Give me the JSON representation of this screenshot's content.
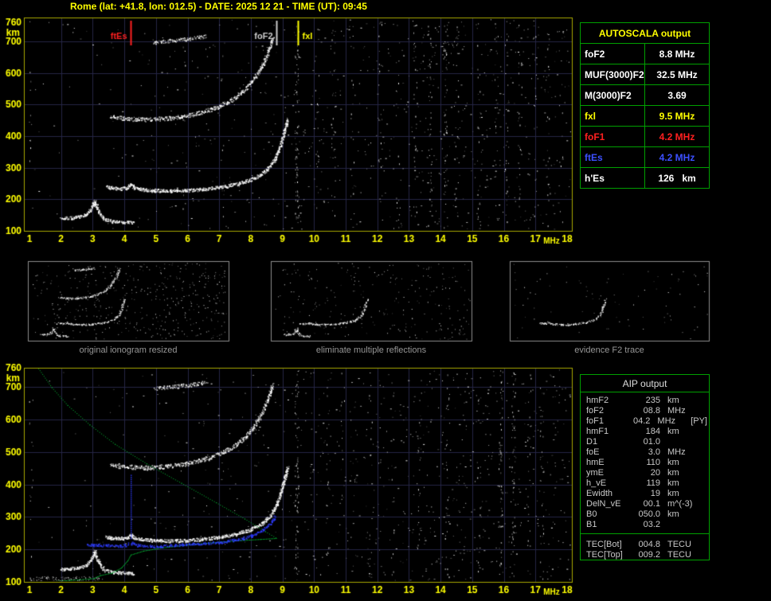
{
  "title": "Rome (lat: +41.8, lon: 012.5) - DATE: 2025 12 21 - TIME (UT): 09:45",
  "colors": {
    "background": "#000000",
    "axis_text": "#ffff00",
    "plot_border": "#a8a800",
    "grid": "#262646",
    "trace_white": "#ffffff",
    "profile_green": "#00b432",
    "restored_blue": "#2e3cff",
    "table_border": "#00a000",
    "caption_gray": "#969696",
    "aip_text": "#c8c8c8",
    "thumb_border": "#8c8c8c"
  },
  "ionogram_axes": {
    "x_ticks": [
      1,
      2,
      3,
      4,
      5,
      6,
      7,
      8,
      9,
      10,
      11,
      12,
      13,
      14,
      15,
      16,
      17,
      18
    ],
    "x_unit": "MHz",
    "y_ticks": [
      100,
      200,
      300,
      400,
      500,
      600,
      700,
      760
    ],
    "y_unit": "km",
    "x_range": [
      1,
      18
    ],
    "y_range": [
      100,
      760
    ]
  },
  "markers": [
    {
      "label": "ftEs",
      "freq": 4.2,
      "color": "#ff2020",
      "label_side": "left"
    },
    {
      "label": "foF2",
      "freq": 8.8,
      "color": "#cccccc",
      "label_side": "left"
    },
    {
      "label": "fxl",
      "freq": 9.5,
      "color": "#ffff00",
      "label_side": "right"
    }
  ],
  "autoscala_table": {
    "header": "AUTOSCALA output",
    "rows": [
      {
        "param": "foF2",
        "value": "8.8 MHz",
        "color": "#ffffff"
      },
      {
        "param": "MUF(3000)F2",
        "value": "32.5 MHz",
        "color": "#ffffff"
      },
      {
        "param": "M(3000)F2",
        "value": "3.69",
        "color": "#ffffff"
      },
      {
        "param": "fxl",
        "value": "9.5 MHz",
        "color": "#ffff00"
      },
      {
        "param": "foF1",
        "value": "4.2 MHz",
        "color": "#ff2020"
      },
      {
        "param": "ftEs",
        "value": "4.2 MHz",
        "color": "#3c50ff"
      },
      {
        "param": "h'Es",
        "value": "126   km",
        "color": "#ffffff"
      }
    ]
  },
  "thumbnails": [
    {
      "caption": "original ionogram resized"
    },
    {
      "caption": "eliminate multiple reflections"
    },
    {
      "caption": "evidence F2 trace"
    }
  ],
  "aip_table": {
    "header": "AIP output",
    "rows": [
      {
        "param": "hmF2",
        "value": "235",
        "unit": "km",
        "note": ""
      },
      {
        "param": "foF2",
        "value": "08.8",
        "unit": "MHz",
        "note": ""
      },
      {
        "param": "foF1",
        "value": "04.2",
        "unit": "MHz",
        "note": "[PY]"
      },
      {
        "param": "hmF1",
        "value": "184",
        "unit": "km",
        "note": ""
      },
      {
        "param": "D1",
        "value": "01.0",
        "unit": "",
        "note": ""
      },
      {
        "param": "foE",
        "value": "3.0",
        "unit": "MHz",
        "note": ""
      },
      {
        "param": "hmE",
        "value": "110",
        "unit": "km",
        "note": ""
      },
      {
        "param": "ymE",
        "value": "20",
        "unit": "km",
        "note": ""
      },
      {
        "param": "h_vE",
        "value": "119",
        "unit": "km",
        "note": ""
      },
      {
        "param": "Ewidth",
        "value": "19",
        "unit": "km",
        "note": ""
      },
      {
        "param": "DelN_vE",
        "value": "00.1",
        "unit": "m^(-3)",
        "note": ""
      },
      {
        "param": "B0",
        "value": "050.0",
        "unit": "km",
        "note": ""
      },
      {
        "param": "B1",
        "value": "03.2",
        "unit": "",
        "note": ""
      }
    ],
    "tec_rows": [
      {
        "param": "TEC[Bot]",
        "value": "004.8",
        "unit": "TECU",
        "note": ""
      },
      {
        "param": "TEC[Top]",
        "value": "009.2",
        "unit": "TECU",
        "note": ""
      }
    ]
  },
  "chart_data": {
    "type": "scatter",
    "title": "ionogram echo traces (virtual height vs frequency)",
    "xlabel": "MHz",
    "ylabel": "km",
    "xlim": [
      1,
      18
    ],
    "ylim": [
      100,
      760
    ],
    "traces": {
      "es_e_trace": [
        [
          2.0,
          140
        ],
        [
          2.5,
          144
        ],
        [
          2.8,
          152
        ],
        [
          2.95,
          172
        ],
        [
          3.05,
          196
        ],
        [
          3.18,
          162
        ],
        [
          3.35,
          138
        ],
        [
          3.7,
          130
        ],
        [
          4.3,
          127
        ]
      ],
      "f_trace": [
        [
          3.4,
          240
        ],
        [
          3.8,
          234
        ],
        [
          4.1,
          238
        ],
        [
          4.2,
          248
        ],
        [
          4.3,
          237
        ],
        [
          4.7,
          230
        ],
        [
          5.2,
          228
        ],
        [
          5.8,
          228
        ],
        [
          6.4,
          232
        ],
        [
          7.0,
          239
        ],
        [
          7.5,
          248
        ],
        [
          7.95,
          261
        ],
        [
          8.3,
          278
        ],
        [
          8.55,
          299
        ],
        [
          8.75,
          327
        ],
        [
          8.9,
          362
        ],
        [
          9.0,
          398
        ],
        [
          9.1,
          432
        ],
        [
          9.16,
          455
        ]
      ],
      "f_trace_second_order": [
        [
          3.55,
          462
        ],
        [
          4.1,
          456
        ],
        [
          4.7,
          453
        ],
        [
          5.3,
          457
        ],
        [
          5.9,
          464
        ],
        [
          6.4,
          475
        ],
        [
          6.9,
          491
        ],
        [
          7.4,
          515
        ],
        [
          7.8,
          546
        ],
        [
          8.1,
          582
        ],
        [
          8.35,
          622
        ],
        [
          8.55,
          668
        ],
        [
          8.68,
          712
        ]
      ],
      "f_trace_third_order": [
        [
          4.9,
          696
        ],
        [
          5.5,
          703
        ],
        [
          6.1,
          709
        ],
        [
          6.6,
          717
        ]
      ]
    },
    "profile": {
      "topside": [
        [
          1.28,
          758
        ],
        [
          1.7,
          700
        ],
        [
          2.2,
          645
        ],
        [
          2.9,
          585
        ],
        [
          3.7,
          525
        ],
        [
          4.7,
          465
        ],
        [
          5.8,
          405
        ],
        [
          6.9,
          345
        ],
        [
          7.8,
          295
        ],
        [
          8.45,
          256
        ],
        [
          8.78,
          237
        ]
      ],
      "bottomside": [
        [
          1.7,
          102
        ],
        [
          2.3,
          106
        ],
        [
          2.9,
          110
        ],
        [
          3.05,
          112
        ],
        [
          3.15,
          117
        ],
        [
          3.25,
          121
        ],
        [
          3.6,
          128
        ],
        [
          3.9,
          144
        ],
        [
          4.1,
          166
        ],
        [
          4.2,
          184
        ],
        [
          4.6,
          196
        ],
        [
          5.2,
          206
        ],
        [
          6.0,
          215
        ],
        [
          6.8,
          222
        ],
        [
          7.6,
          228
        ],
        [
          8.3,
          232
        ],
        [
          8.8,
          235
        ]
      ]
    },
    "restored_trace": {
      "points": [
        [
          2.85,
          216
        ],
        [
          3.3,
          214
        ],
        [
          3.7,
          212
        ],
        [
          4.05,
          214
        ],
        [
          4.2,
          222
        ],
        [
          4.35,
          215
        ],
        [
          4.8,
          212
        ],
        [
          5.4,
          213
        ],
        [
          6.0,
          216
        ],
        [
          6.6,
          220
        ],
        [
          7.2,
          226
        ],
        [
          7.7,
          234
        ],
        [
          8.1,
          246
        ],
        [
          8.4,
          262
        ],
        [
          8.6,
          282
        ],
        [
          8.75,
          305
        ]
      ],
      "spike": {
        "freq": 4.2,
        "km_from": 235,
        "km_to": 430
      }
    },
    "noise": {
      "top_salt": 760,
      "bottom_salt": 820,
      "top_streaks": [
        [
          1.05,
          12
        ],
        [
          5.9,
          10
        ],
        [
          7.1,
          8
        ],
        [
          9.45,
          80
        ],
        [
          10.1,
          18
        ],
        [
          10.6,
          24
        ],
        [
          11.2,
          16
        ],
        [
          12.1,
          20
        ],
        [
          12.65,
          16
        ],
        [
          13.2,
          28
        ],
        [
          13.65,
          34
        ],
        [
          14.15,
          44
        ],
        [
          14.5,
          24
        ],
        [
          15.2,
          18
        ],
        [
          15.75,
          16
        ],
        [
          16.1,
          28
        ],
        [
          16.5,
          26
        ],
        [
          17.0,
          18
        ],
        [
          17.4,
          20
        ],
        [
          17.8,
          14
        ]
      ],
      "bottom_streaks": [
        [
          1.05,
          14
        ],
        [
          9.45,
          70
        ],
        [
          10.4,
          18
        ],
        [
          10.9,
          12
        ],
        [
          11.8,
          14
        ],
        [
          12.5,
          14
        ],
        [
          13.3,
          22
        ],
        [
          14.2,
          30
        ],
        [
          15.2,
          15
        ],
        [
          15.9,
          55
        ],
        [
          16.3,
          50
        ],
        [
          16.8,
          18
        ],
        [
          17.2,
          22
        ]
      ],
      "bottom_band": {
        "count": 130,
        "f_range": [
          1.0,
          3.3
        ],
        "km_range": [
          100,
          118
        ]
      },
      "top_cluster": {
        "count": 28,
        "f_range": [
          13.3,
          14.6
        ],
        "km_range": [
          610,
          745
        ]
      }
    }
  }
}
